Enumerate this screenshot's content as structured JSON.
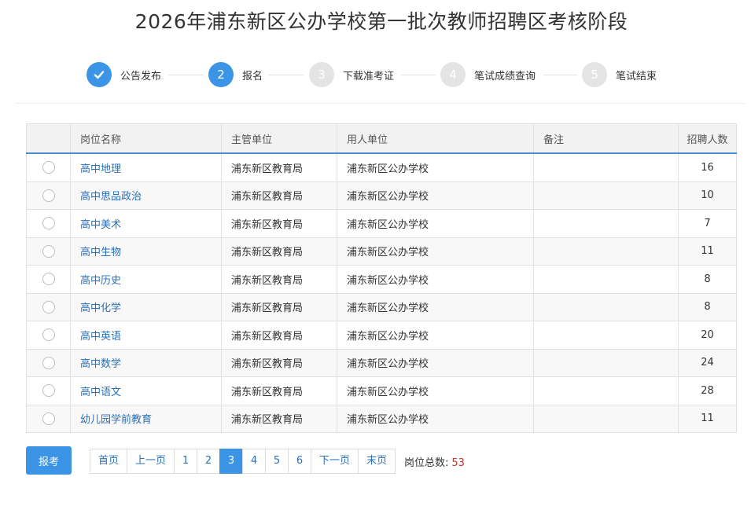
{
  "title": "2026年浦东新区公办学校第一批次教师招聘区考核阶段",
  "steps": [
    {
      "num": "✓",
      "label": "公告发布",
      "state": "done"
    },
    {
      "num": "2",
      "label": "报名",
      "state": "active"
    },
    {
      "num": "3",
      "label": "下载准考证",
      "state": "pending"
    },
    {
      "num": "4",
      "label": "笔试成绩查询",
      "state": "pending"
    },
    {
      "num": "5",
      "label": "笔试结束",
      "state": "pending"
    }
  ],
  "table": {
    "headers": {
      "position": "岗位名称",
      "authority": "主管单位",
      "employer": "用人单位",
      "remark": "备注",
      "count": "招聘人数"
    },
    "rows": [
      {
        "position": "高中地理",
        "authority": "浦东新区教育局",
        "employer": "浦东新区公办学校",
        "remark": "",
        "count": "16"
      },
      {
        "position": "高中思品政治",
        "authority": "浦东新区教育局",
        "employer": "浦东新区公办学校",
        "remark": "",
        "count": "10"
      },
      {
        "position": "高中美术",
        "authority": "浦东新区教育局",
        "employer": "浦东新区公办学校",
        "remark": "",
        "count": "7"
      },
      {
        "position": "高中生物",
        "authority": "浦东新区教育局",
        "employer": "浦东新区公办学校",
        "remark": "",
        "count": "11"
      },
      {
        "position": "高中历史",
        "authority": "浦东新区教育局",
        "employer": "浦东新区公办学校",
        "remark": "",
        "count": "8"
      },
      {
        "position": "高中化学",
        "authority": "浦东新区教育局",
        "employer": "浦东新区公办学校",
        "remark": "",
        "count": "8"
      },
      {
        "position": "高中英语",
        "authority": "浦东新区教育局",
        "employer": "浦东新区公办学校",
        "remark": "",
        "count": "20"
      },
      {
        "position": "高中数学",
        "authority": "浦东新区教育局",
        "employer": "浦东新区公办学校",
        "remark": "",
        "count": "24"
      },
      {
        "position": "高中语文",
        "authority": "浦东新区教育局",
        "employer": "浦东新区公办学校",
        "remark": "",
        "count": "28"
      },
      {
        "position": "幼儿园学前教育",
        "authority": "浦东新区教育局",
        "employer": "浦东新区公办学校",
        "remark": "",
        "count": "11"
      }
    ]
  },
  "footer": {
    "apply_label": "报考",
    "pager": {
      "first": "首页",
      "prev": "上一页",
      "pages": [
        "1",
        "2",
        "3",
        "4",
        "5",
        "6"
      ],
      "current": "3",
      "next": "下一页",
      "last": "末页"
    },
    "total_label": "岗位总数:",
    "total_value": "53"
  },
  "colors": {
    "accent": "#3b94e6",
    "link": "#2a70b8",
    "total": "#c0392b"
  }
}
